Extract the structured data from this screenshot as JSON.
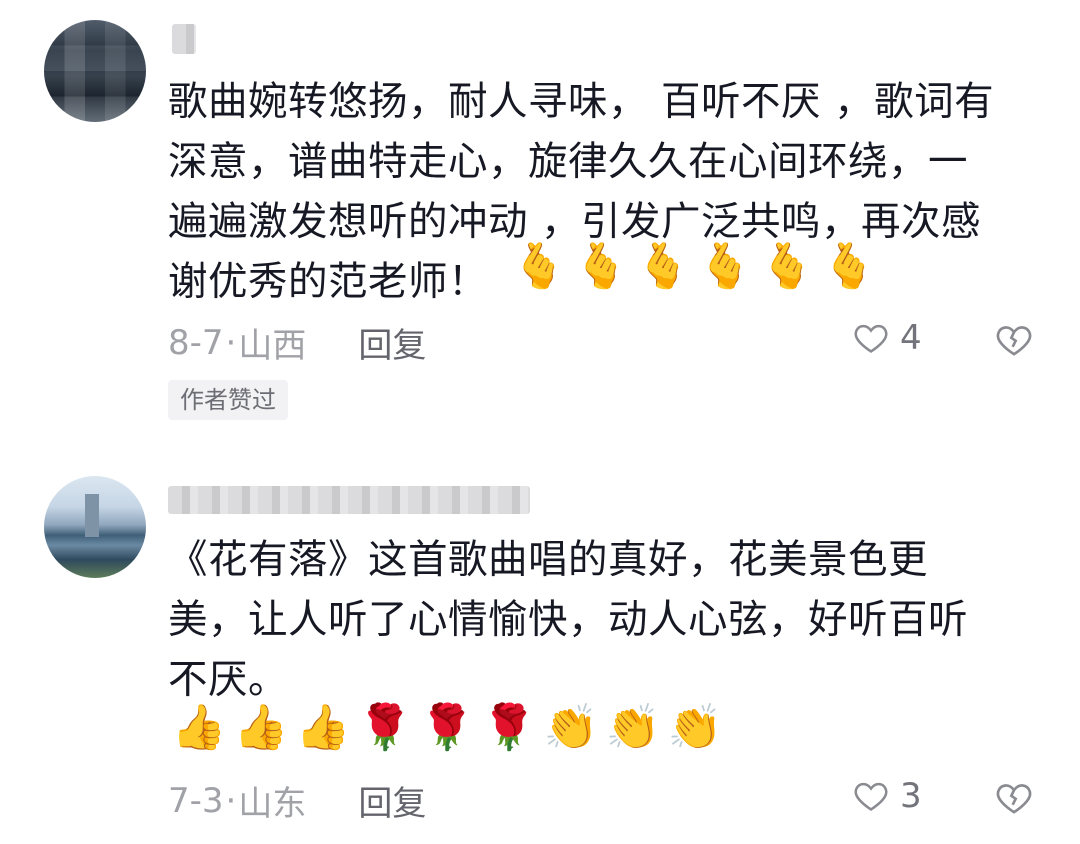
{
  "comments": [
    {
      "lines": [
        "歌曲婉转悠扬，耐人寻味， 百听不厌 ，歌词有",
        "深意，谱曲特走心，旋律久久在心间环绕，一",
        "遍遍激发想听的冲动 ，引发广泛共鸣，再次感",
        "谢优秀的范老师！"
      ],
      "emojis": [
        "🫰",
        "🫰",
        "🫰",
        "🫰",
        "🫰",
        "🫰"
      ],
      "emoji_names": [
        "finger-heart-icon",
        "finger-heart-icon",
        "finger-heart-icon",
        "finger-heart-icon",
        "finger-heart-icon",
        "finger-heart-icon"
      ],
      "date": "8-7",
      "dot": "·",
      "location": "山西",
      "reply_label": "回复",
      "likes": "4",
      "badge": "作者赞过"
    },
    {
      "lines": [
        "《花有落》这首歌曲唱的真好，花美景色更",
        "美，让人听了心情愉快，动人心弦，好听百听",
        "不厌。"
      ],
      "emojis": [
        "👍",
        "👍",
        "👍",
        "🌹",
        "🌹",
        "🌹",
        "👏",
        "👏",
        "👏"
      ],
      "emoji_names": [
        "thumbs-up-icon",
        "thumbs-up-icon",
        "thumbs-up-icon",
        "rose-icon",
        "rose-icon",
        "rose-icon",
        "clapping-hands-icon",
        "clapping-hands-icon",
        "clapping-hands-icon"
      ],
      "date": "7-3",
      "dot": "·",
      "location": "山东",
      "reply_label": "回复",
      "likes": "3"
    }
  ],
  "colors": {
    "text": "#161823",
    "meta": "#a1a2a7",
    "reply": "#64656c",
    "badge_bg": "#f2f2f4"
  }
}
